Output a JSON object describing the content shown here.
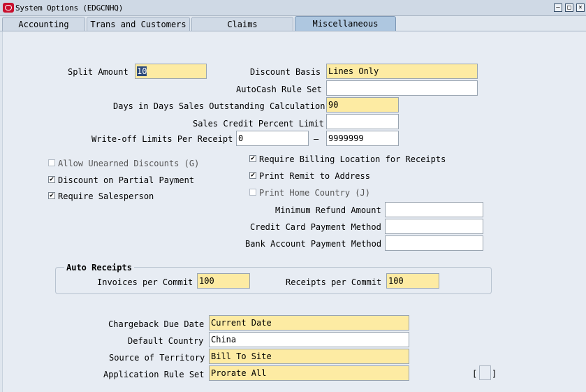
{
  "window": {
    "title": "System Options (EDGCNHQ)",
    "minimize_icon": "minimize-icon",
    "maximize_icon": "maximize-icon"
  },
  "tabs": [
    {
      "label": "Accounting",
      "active": false
    },
    {
      "label": "Trans and Customers",
      "active": false
    },
    {
      "label": "Claims",
      "active": false
    },
    {
      "label": "Miscellaneous",
      "active": true
    }
  ],
  "form": {
    "split_amount": {
      "label": "Split Amount",
      "value": "10"
    },
    "discount_basis": {
      "label": "Discount Basis",
      "value": "Lines Only"
    },
    "autocash_rule_set": {
      "label": "AutoCash Rule Set",
      "value": ""
    },
    "dso_calc": {
      "label": "Days in Days Sales Outstanding Calculation",
      "value": "90"
    },
    "sales_credit_pct": {
      "label": "Sales Credit Percent Limit",
      "value": ""
    },
    "writeoff_limits": {
      "label": "Write-off Limits Per Receipt",
      "from": "0",
      "separator": "–",
      "to": "9999999"
    },
    "checkboxes_left": [
      {
        "label": "Allow Unearned Discounts (G)",
        "checked": false,
        "enabled": false
      },
      {
        "label": "Discount on Partial Payment",
        "checked": true,
        "enabled": true
      },
      {
        "label": "Require Salesperson",
        "checked": true,
        "enabled": true
      }
    ],
    "checkboxes_right": [
      {
        "label": "Require Billing Location for Receipts",
        "checked": true,
        "enabled": true
      },
      {
        "label": "Print Remit to Address",
        "checked": true,
        "enabled": true
      },
      {
        "label": "Print Home Country (J)",
        "checked": false,
        "enabled": false
      }
    ],
    "min_refund_amount": {
      "label": "Minimum Refund Amount",
      "value": ""
    },
    "credit_card_method": {
      "label": "Credit Card Payment Method",
      "value": ""
    },
    "bank_account_method": {
      "label": "Bank Account Payment Method",
      "value": ""
    },
    "auto_receipts": {
      "title": "Auto Receipts",
      "invoices_per_commit": {
        "label": "Invoices per Commit",
        "value": "100"
      },
      "receipts_per_commit": {
        "label": "Receipts per Commit",
        "value": "100"
      }
    },
    "chargeback_due_date": {
      "label": "Chargeback Due Date",
      "value": "Current Date"
    },
    "default_country": {
      "label": "Default Country",
      "value": "China"
    },
    "source_of_territory": {
      "label": "Source of Territory",
      "value": "Bill To Site"
    },
    "application_rule_set": {
      "label": "Application Rule Set",
      "value": "Prorate All"
    },
    "descriptive_flexfield": {
      "open": "[",
      "close": "]"
    }
  },
  "colors": {
    "required_field": "#fdeba3",
    "active_tab": "#aec7e0",
    "background": "#e7ecf3"
  }
}
